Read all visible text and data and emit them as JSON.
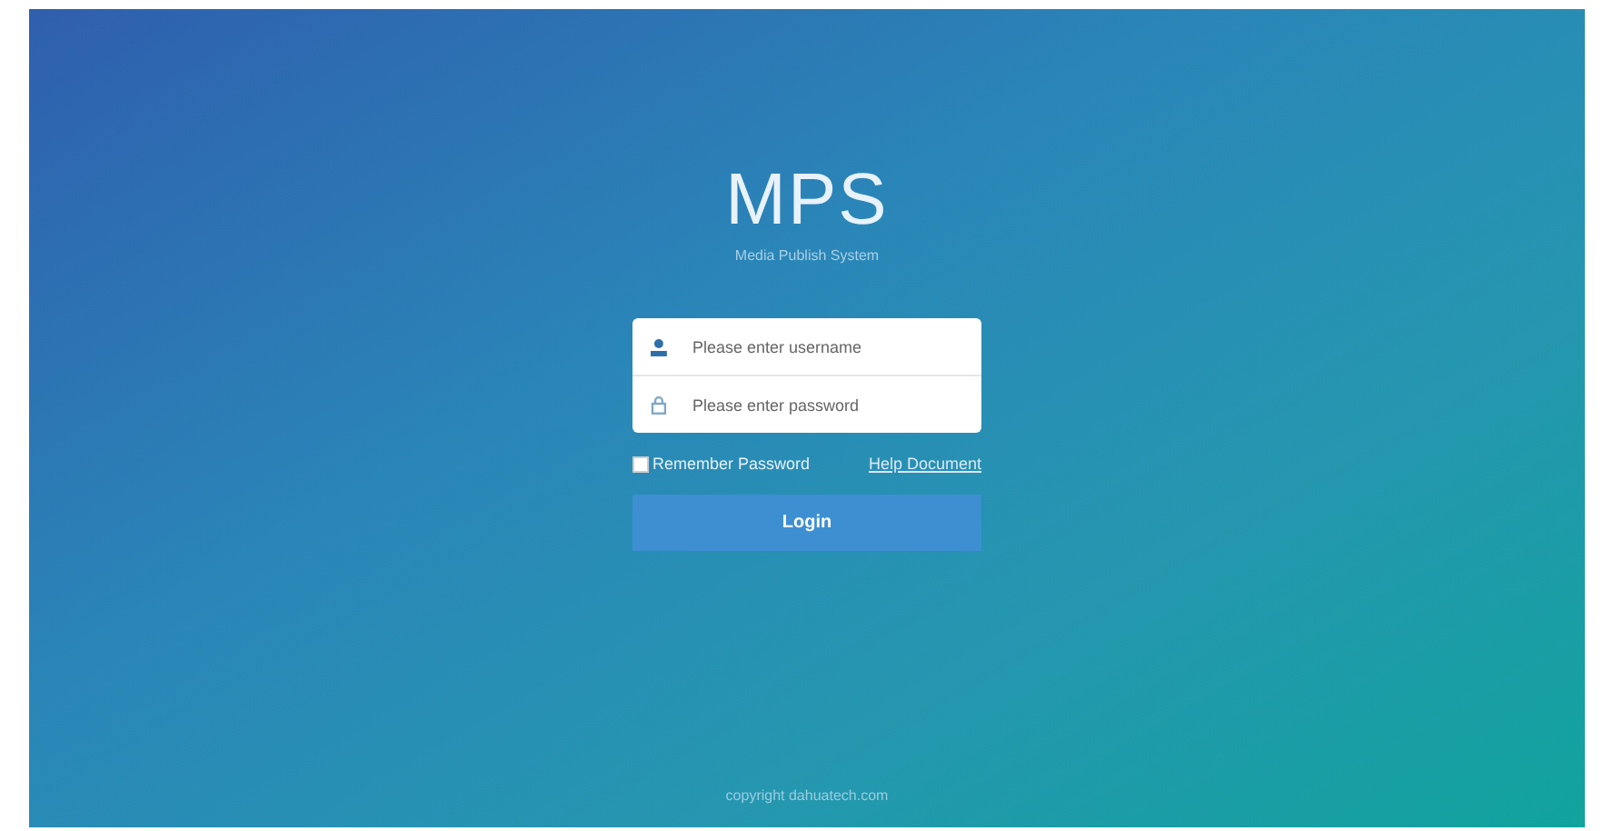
{
  "brand": {
    "title": "MPS",
    "subtitle": "Media Publish System"
  },
  "username": {
    "placeholder": "Please enter username"
  },
  "password": {
    "placeholder": "Please enter password"
  },
  "remember": {
    "label": "Remember Password",
    "checked": false
  },
  "help_link": "Help Document",
  "login_button": "Login",
  "footer": "copyright dahuatech.com"
}
